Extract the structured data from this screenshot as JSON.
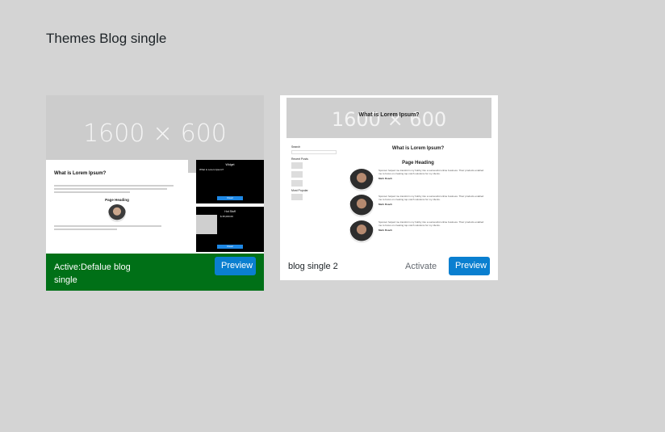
{
  "page": {
    "title": "Themes Blog single"
  },
  "themes": [
    {
      "name": "Active:Defalue blog single",
      "active": true,
      "preview_label": "Preview",
      "bar_color": "#007017",
      "screenshot": {
        "placeholder": "1600 × 600",
        "heading": "What is Lorem Ipsum?",
        "subheading": "Page Heading",
        "widget_title": "Widget",
        "widget_text": "What is Lorem Ipsum?",
        "widget_button": "Read",
        "widget2_title": "Hot Stuff",
        "widget2_text": "$ 35,000.00",
        "widget2_button": "Read"
      }
    },
    {
      "name": "blog single 2",
      "active": false,
      "activate_label": "Activate",
      "preview_label": "Preview",
      "screenshot": {
        "placeholder": "1600 × 600",
        "banner_title": "What is Lorem Ipsum?",
        "heading": "What is Lorem Ipsum?",
        "subheading": "Page Heading",
        "sidebar_search": "Search",
        "sidebar_recent": "Recent Posts",
        "sidebar_popular": "Most Popular",
        "testimonials": [
          {
            "text": "Sponsor helped me transform my hobby into a successful online business. Their products enabled me to focus on creating top-notch solutions for my clients.",
            "name": "Mark Roach"
          },
          {
            "text": "Sponsor helped me transform my hobby into a successful online business. Their products enabled me to focus on creating top-notch solutions for my clients.",
            "name": "Mark Roach"
          },
          {
            "text": "Sponsor helped me transform my hobby into a successful online business. Their products enabled me to focus on creating top-notch solutions for my clients.",
            "name": "Mark Roach"
          }
        ]
      }
    }
  ],
  "colors": {
    "background": "#d4d4d4",
    "active_bar": "#007017",
    "primary_button": "#0a7fd0"
  },
  "icons": {
    "avatar": "person-photo-icon"
  }
}
